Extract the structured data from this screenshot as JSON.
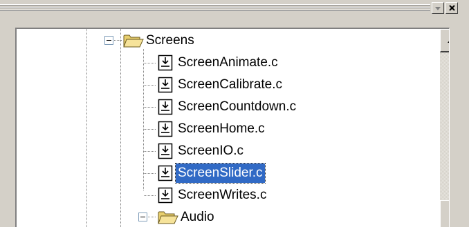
{
  "window": {
    "colors": {
      "face": "#d4d0c8",
      "selection": "#316ac5",
      "selection_text": "#ffffff",
      "tree_bg": "#ffffff"
    }
  },
  "titlebar": {
    "buttons": [
      {
        "name": "dropdown",
        "icon": "chevron-down-icon"
      },
      {
        "name": "close",
        "icon": "close-icon"
      }
    ]
  },
  "tree": {
    "nodes": [
      {
        "label": "Screens",
        "type": "folder",
        "expanded": true,
        "level": 0
      },
      {
        "label": "ScreenAnimate.c",
        "type": "file",
        "level": 1
      },
      {
        "label": "ScreenCalibrate.c",
        "type": "file",
        "level": 1
      },
      {
        "label": "ScreenCountdown.c",
        "type": "file",
        "level": 1
      },
      {
        "label": "ScreenHome.c",
        "type": "file",
        "level": 1
      },
      {
        "label": "ScreenIO.c",
        "type": "file",
        "level": 1
      },
      {
        "label": "ScreenSlider.c",
        "type": "file",
        "level": 1,
        "selected": true
      },
      {
        "label": "ScreenWrites.c",
        "type": "file",
        "level": 1
      },
      {
        "label": "Audio",
        "type": "folder",
        "expanded": true,
        "level": 0
      }
    ]
  },
  "scrollbar": {
    "up_icon": "arrow-up-icon"
  }
}
